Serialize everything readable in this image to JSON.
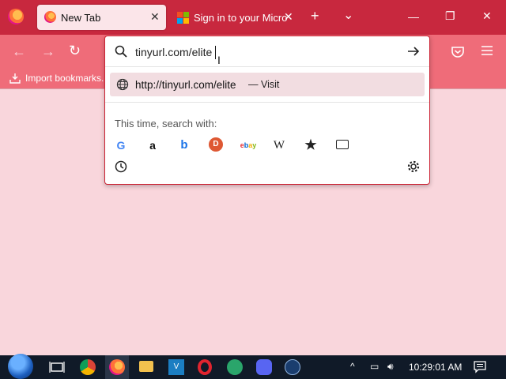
{
  "tabs": [
    {
      "title": "New Tab",
      "close": "✕",
      "active": true
    },
    {
      "title": "Sign in to your Micro",
      "close": "✕",
      "active": false
    }
  ],
  "tabstrip": {
    "new_tab": "+",
    "list_all": "⌄"
  },
  "window": {
    "minimize": "—",
    "maximize": "❐",
    "close": "✕"
  },
  "bookmarks": {
    "import_label": "Import bookmarks..."
  },
  "urlbar": {
    "value": "tinyurl.com/elite"
  },
  "suggestion": {
    "url": "http://tinyurl.com/elite",
    "separator": "—",
    "action": "Visit"
  },
  "search_with": {
    "label": "This time, search with:"
  },
  "engines": [
    "Google",
    "Amazon",
    "Bing",
    "DuckDuckGo",
    "eBay",
    "Wikipedia",
    "Bookmarks",
    "Tabs"
  ],
  "clock": {
    "time": "10:29:01 AM"
  },
  "colors": {
    "tabstrip": "#c8283e",
    "toolbar": "#ef6c79",
    "page": "#f9d6dc",
    "taskbar": "#101a28"
  }
}
